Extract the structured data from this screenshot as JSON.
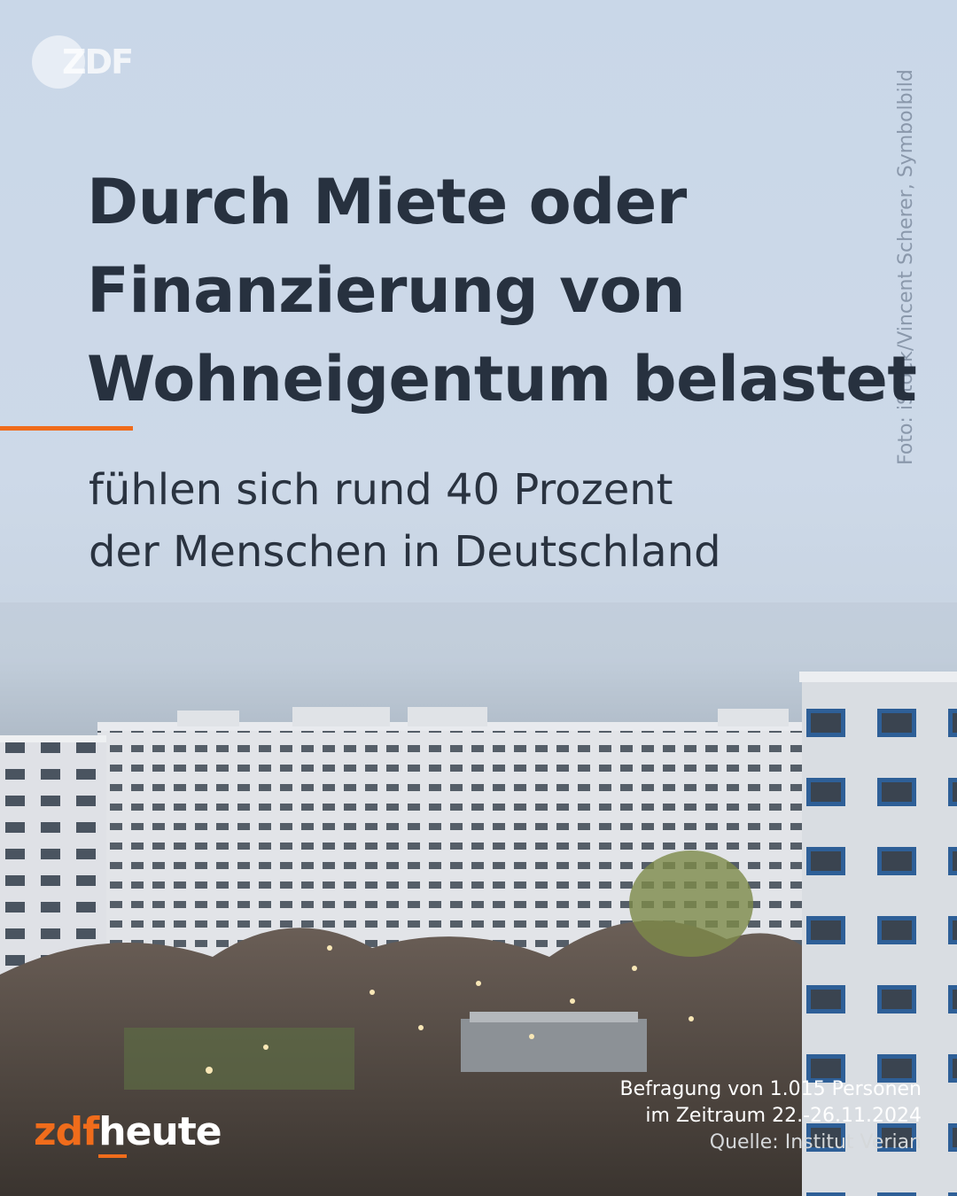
{
  "brand": {
    "badge_text": "ZDF",
    "footer_logo_part1": "zdf",
    "footer_logo_part2": "heute",
    "accent_color": "#f06c1b"
  },
  "photo_credit": "Foto: iStock/Vincent Scherer, Symbolbild",
  "headline": {
    "lines": [
      "Durch Miete oder",
      "Finanzierung von",
      "Wohneigentum belastet"
    ]
  },
  "subline": {
    "lines": [
      "fühlen sich rund 40 Prozent",
      "der Menschen in Deutschland"
    ]
  },
  "source": {
    "line1": "Befragung von 1.015 Personen",
    "line2": "im Zeitraum 22.-26.11.2024",
    "line3": "Quelle: Institut Verian"
  },
  "colors": {
    "headline_text": "#27313f",
    "sky": "#c9d7e8"
  }
}
